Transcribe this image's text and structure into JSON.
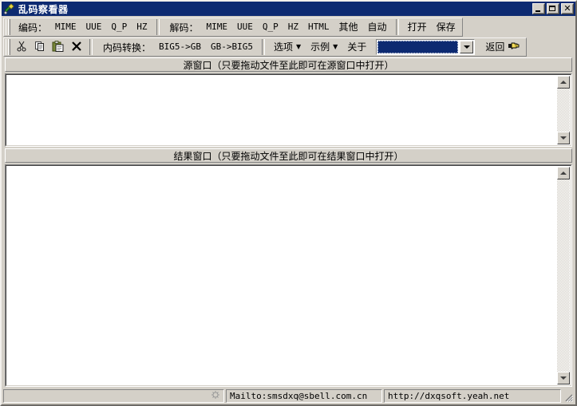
{
  "window": {
    "title": "乱码察看器",
    "icon": "app-icon",
    "controls": {
      "minimize": "_",
      "maximize": "□",
      "close": "✕"
    },
    "colors": {
      "titlebar": "#0d2a71",
      "face": "#d4d0c8",
      "highlight": "#ffffff",
      "shadow": "#808080",
      "text": "#000000"
    }
  },
  "toolbar_row1": {
    "encode_label": "编码：",
    "encode_items": [
      "MIME",
      "UUE",
      "Q_P",
      "HZ"
    ],
    "decode_label": "解码：",
    "decode_items": [
      "MIME",
      "UUE",
      "Q_P",
      "HZ",
      "HTML",
      "其他",
      "自动"
    ],
    "file_items": [
      "打开",
      "保存"
    ]
  },
  "toolbar_row2": {
    "clipboard_icons": [
      {
        "name": "cut-icon",
        "glyph": "✂"
      },
      {
        "name": "copy-icon",
        "glyph": "❐"
      },
      {
        "name": "paste-icon",
        "glyph": "📋"
      },
      {
        "name": "delete-icon",
        "glyph": "✕"
      }
    ],
    "convert_label": "内码转换：",
    "convert_items": [
      "BIG5->GB",
      "GB->BIG5"
    ],
    "menu_items": [
      {
        "label": "选项",
        "has_caret": true
      },
      {
        "label": "示例",
        "has_caret": true
      },
      {
        "label": "关于",
        "has_caret": false
      }
    ],
    "combo": {
      "value": "",
      "placeholder": ""
    },
    "back_button": {
      "label": "返回",
      "icon": "pointing-hand-icon"
    }
  },
  "source_panel": {
    "header": "源窗口（只要拖动文件至此即可在源窗口中打开）",
    "content": ""
  },
  "result_panel": {
    "header": "结果窗口（只要拖动文件至此即可在结果窗口中打开）",
    "content": ""
  },
  "statusbar": {
    "cells": [
      {
        "name": "status-message",
        "text": ""
      },
      {
        "name": "status-mailto",
        "text": "Mailto:smsdxq@sbell.com.cn"
      },
      {
        "name": "status-homepage",
        "text": "http://dxqsoft.yeah.net"
      }
    ],
    "mail_icon": "mail-icon"
  }
}
